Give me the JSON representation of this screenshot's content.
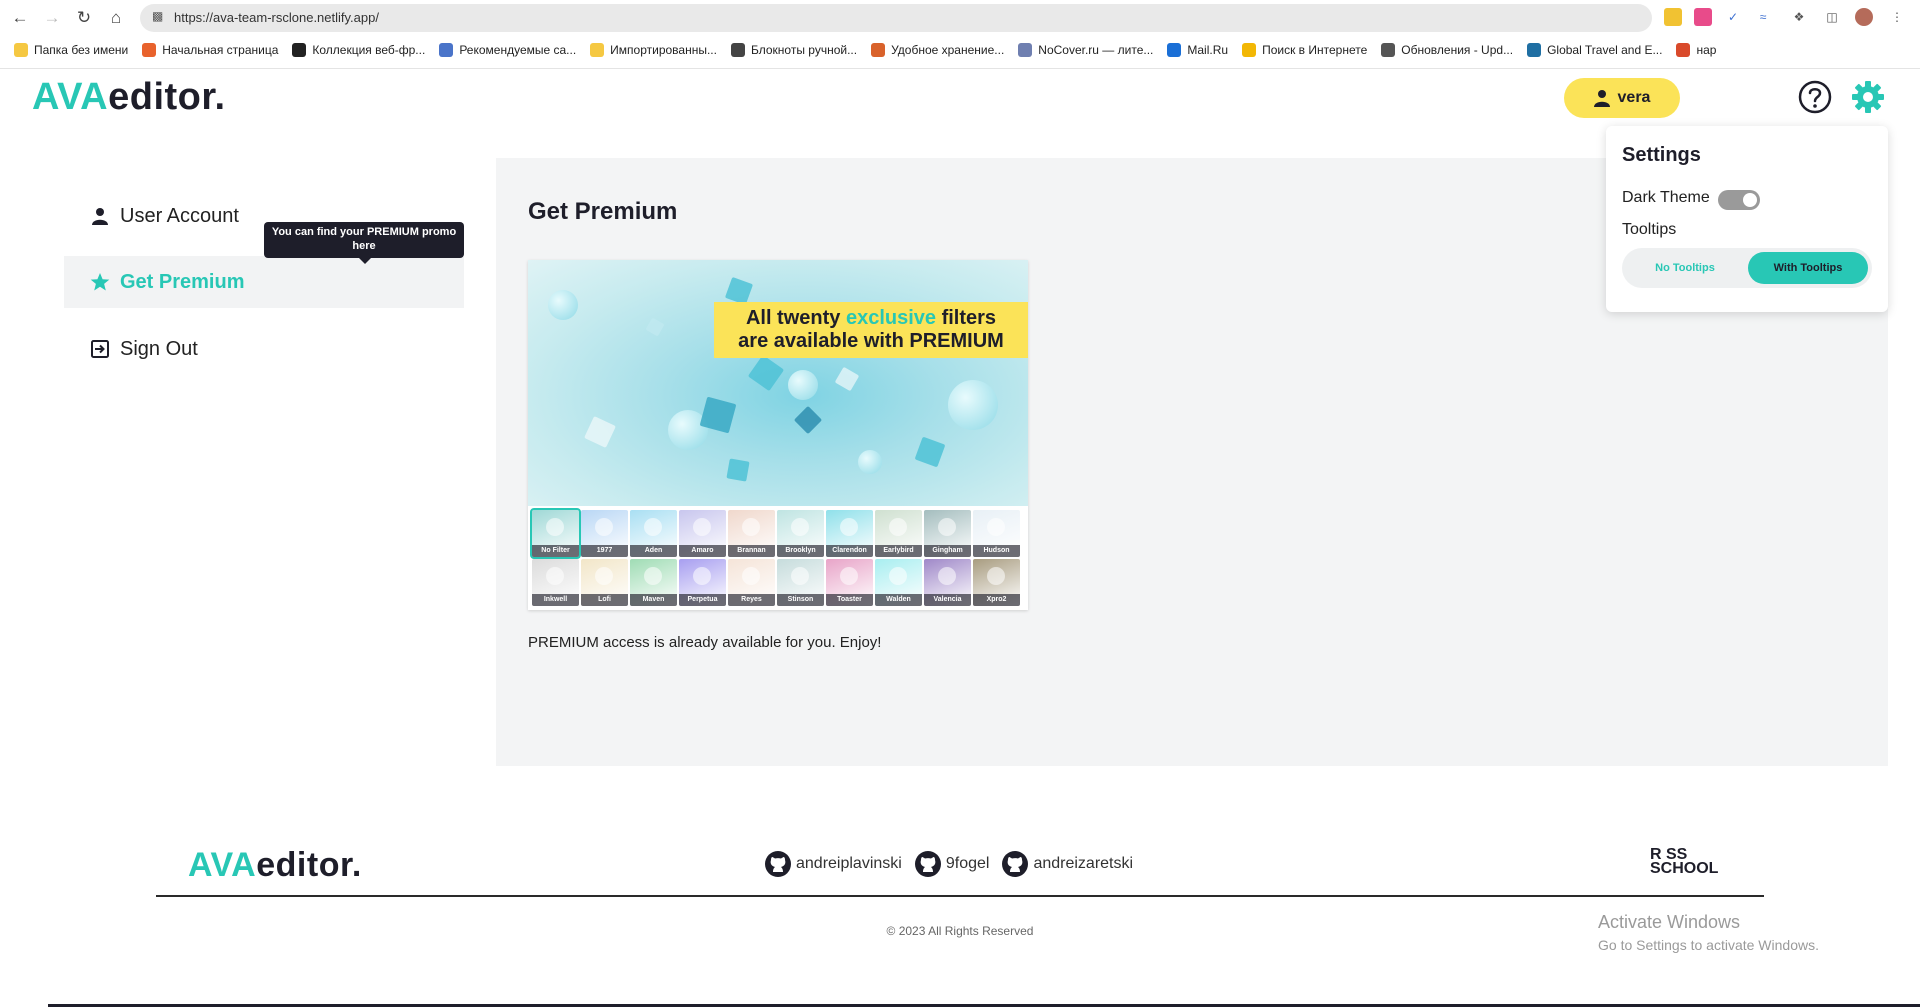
{
  "browser": {
    "url": "https://ava-team-rsclone.netlify.app/",
    "bookmarks": [
      {
        "label": "Папка без имени",
        "color": "#f5c842"
      },
      {
        "label": "Начальная страница",
        "color": "#e8622c"
      },
      {
        "label": "Коллекция веб-фр...",
        "color": "#222222"
      },
      {
        "label": "Рекомендуемые са...",
        "color": "#4a74c9"
      },
      {
        "label": "Импортированны...",
        "color": "#f5c842"
      },
      {
        "label": "Блокноты ручной...",
        "color": "#444444"
      },
      {
        "label": "Удобное хранение...",
        "color": "#d9622b"
      },
      {
        "label": "NoCover.ru — лите...",
        "color": "#6f7fb0"
      },
      {
        "label": "Mail.Ru",
        "color": "#1a6fd6"
      },
      {
        "label": "Поиск в Интернете",
        "color": "#f2b705"
      },
      {
        "label": "Обновления - Upd...",
        "color": "#555555"
      },
      {
        "label": "Global Travel and E...",
        "color": "#1f6fa3"
      },
      {
        "label": "нар",
        "color": "#d94a2b"
      }
    ]
  },
  "header": {
    "logo_accent": "AVA",
    "logo_rest": "editor.",
    "user_name": "vera"
  },
  "sidebar": {
    "items": [
      {
        "label": "User Account",
        "icon": "user-icon"
      },
      {
        "label": "Get Premium",
        "icon": "star-icon"
      },
      {
        "label": "Sign Out",
        "icon": "sign-out-icon"
      }
    ],
    "tooltip": "You can find your PREMIUM promo here"
  },
  "main": {
    "title": "Get Premium",
    "banner_part1": "All twenty ",
    "banner_highlight": "exclusive",
    "banner_part2": " filters",
    "banner_line2": "are available with PREMIUM",
    "filters": [
      "No Filter",
      "1977",
      "Aden",
      "Amaro",
      "Brannan",
      "Brooklyn",
      "Clarendon",
      "Earlybird",
      "Gingham",
      "Hudson",
      "Inkwell",
      "Lofi",
      "Maven",
      "Perpetua",
      "Reyes",
      "Stinson",
      "Toaster",
      "Walden",
      "Valencia",
      "Xpro2"
    ],
    "note": "PREMIUM access is already available for you. Enjoy!"
  },
  "settings": {
    "title": "Settings",
    "dark_theme_label": "Dark Theme",
    "dark_theme_on": true,
    "tooltips_label": "Tooltips",
    "no_tooltips": "No Tooltips",
    "with_tooltips": "With Tooltips",
    "selected": "With Tooltips"
  },
  "footer": {
    "logo_accent": "AVA",
    "logo_rest": "editor.",
    "github_users": [
      "andreiplavinski",
      "9fogel",
      "andreizaretski"
    ],
    "rs_line1": "R   SS",
    "rs_line2": "SCHOOL",
    "copyright": "© 2023 All Rights Reserved"
  },
  "windows_activation": {
    "title": "Activate Windows",
    "subtitle": "Go to Settings to activate Windows."
  },
  "colors": {
    "accent": "#28c7b5",
    "yellow": "#fbe358",
    "dark": "#1e1e2a",
    "panel": "#f3f4f5"
  }
}
